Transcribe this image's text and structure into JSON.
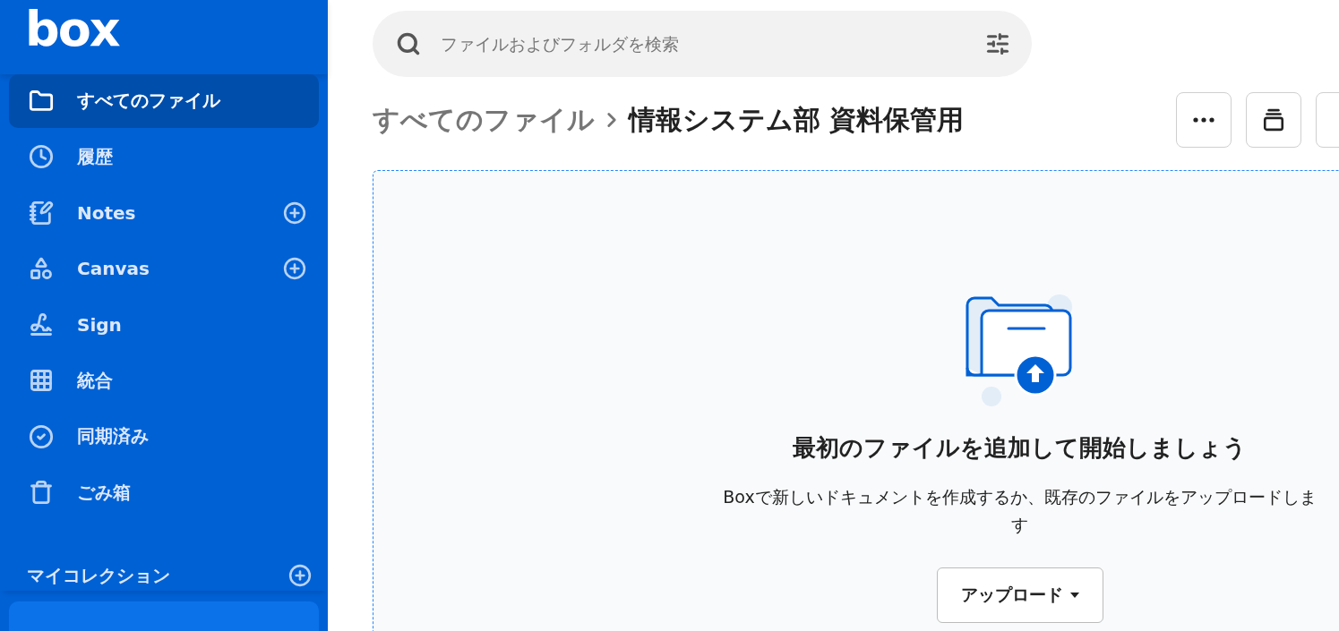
{
  "sidebar": {
    "logo": "box",
    "items": [
      {
        "label": "すべてのファイル",
        "selected": true,
        "add": false
      },
      {
        "label": "履歴",
        "selected": false,
        "add": false
      },
      {
        "label": "Notes",
        "selected": false,
        "add": true
      },
      {
        "label": "Canvas",
        "selected": false,
        "add": true
      },
      {
        "label": "Sign",
        "selected": false,
        "add": false
      },
      {
        "label": "統合",
        "selected": false,
        "add": false
      },
      {
        "label": "同期済み",
        "selected": false,
        "add": false
      },
      {
        "label": "ごみ箱",
        "selected": false,
        "add": false
      }
    ],
    "collections": {
      "title": "マイコレクション",
      "add": true
    }
  },
  "search": {
    "placeholder": "ファイルおよびフォルダを検索"
  },
  "breadcrumb": [
    "すべてのファイル",
    "情報システム部 資料保管用"
  ],
  "empty_state": {
    "title": "最初のファイルを追加して開始しましょう",
    "description": "Boxで新しいドキュメントを作成するか、既存のファイルをアップロードします",
    "button": "アップロード"
  }
}
